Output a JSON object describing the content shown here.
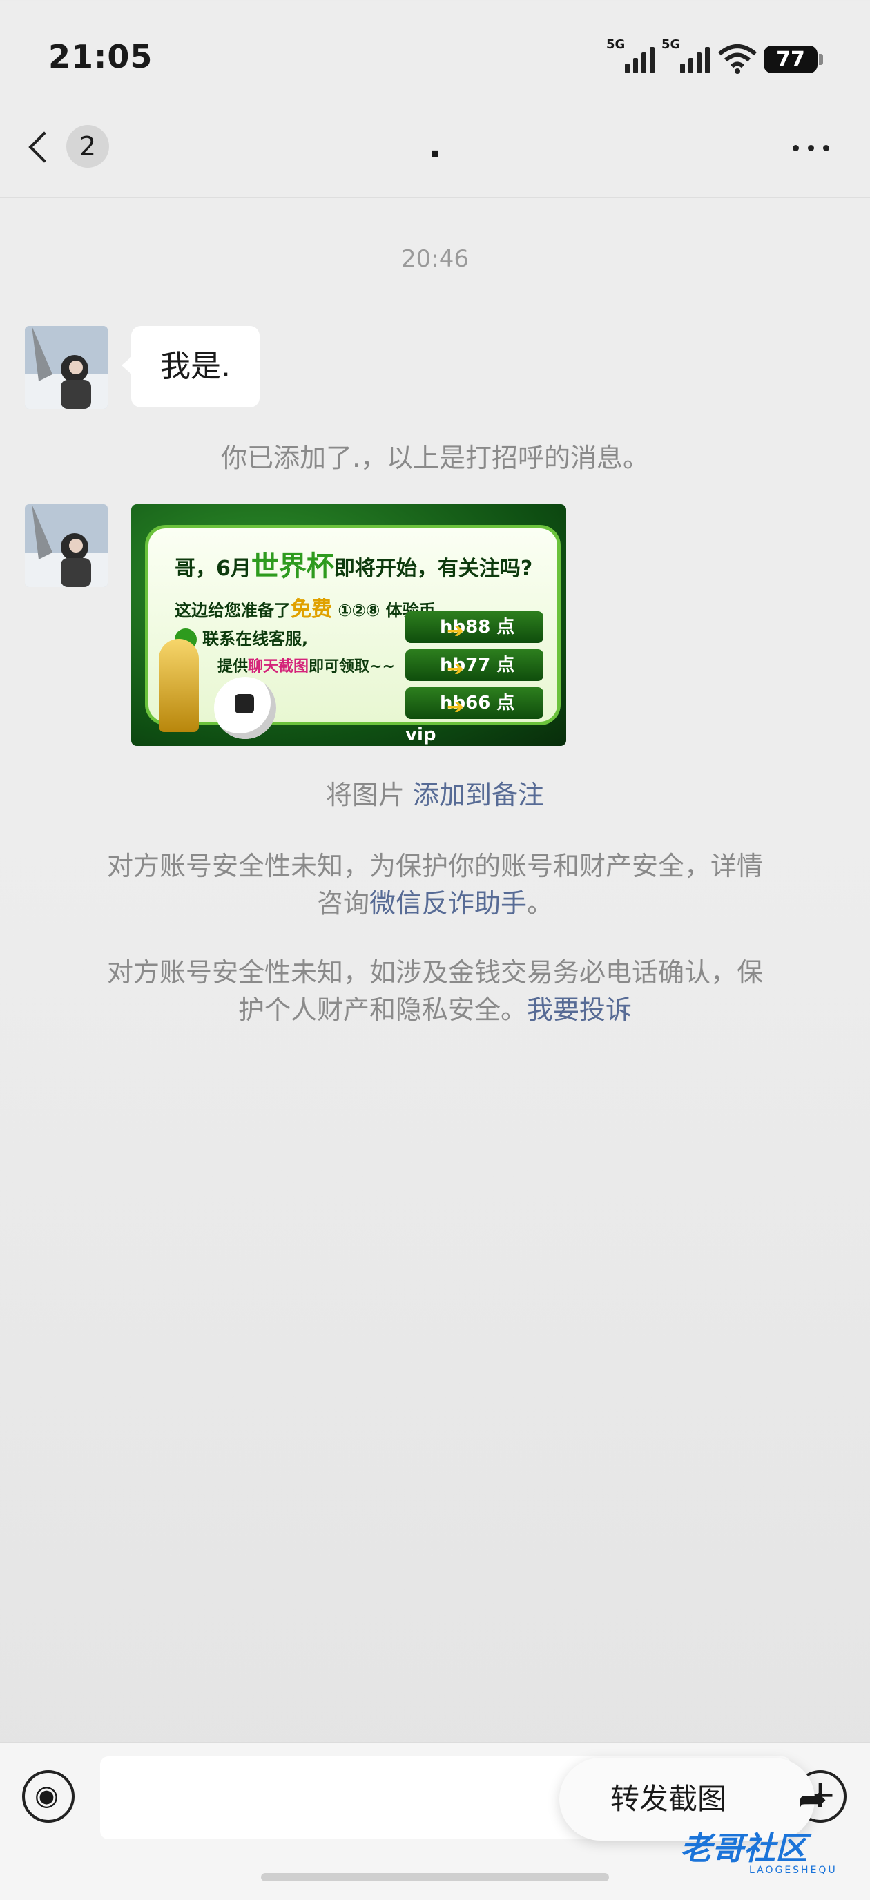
{
  "status_bar": {
    "time": "21:05",
    "network_1": "5G",
    "network_2": "5G",
    "battery": "77"
  },
  "header": {
    "unread_count": "2",
    "title": "."
  },
  "messages": {
    "timestamp": "20:46",
    "text_message": "我是.",
    "added_notice": "你已添加了.，以上是打招呼的消息。"
  },
  "promo_image": {
    "line1_a": "哥，6月",
    "line1_hi": "世界杯",
    "line1_b": "即将开始，有关注吗?",
    "line2_a": "这边给您准备了",
    "line2_hi": "免费",
    "line2_b": " ①②⑧ 体验币",
    "line3": "联系在线客服,",
    "line4_a": "提供",
    "line4_hi": "聊天截图",
    "line4_b": "即可领取~~",
    "buttons": [
      "hb88 点 vip",
      "hb77 点 vip",
      "hb66 点 vip"
    ]
  },
  "image_note": {
    "prefix": "将图片 ",
    "link": "添加到备注"
  },
  "security_1": {
    "text": "对方账号安全性未知，为保护你的账号和财产安全，详情",
    "text2": "咨询",
    "link": "微信反诈助手",
    "end": "。"
  },
  "security_2": {
    "text": "对方账号安全性未知，如涉及金钱交易务必电话确认，保",
    "text2": "护个人财产和隐私安全。",
    "link": "我要投诉"
  },
  "bottom": {
    "forward_label": "转发截图",
    "forward_icon": "share-arrow-icon",
    "plus": "+"
  },
  "watermark": {
    "main": "老哥社区",
    "sub": "LAOGESHEQU"
  },
  "colors": {
    "link": "#576b95",
    "background": "#ededed",
    "bubble": "#ffffff"
  }
}
